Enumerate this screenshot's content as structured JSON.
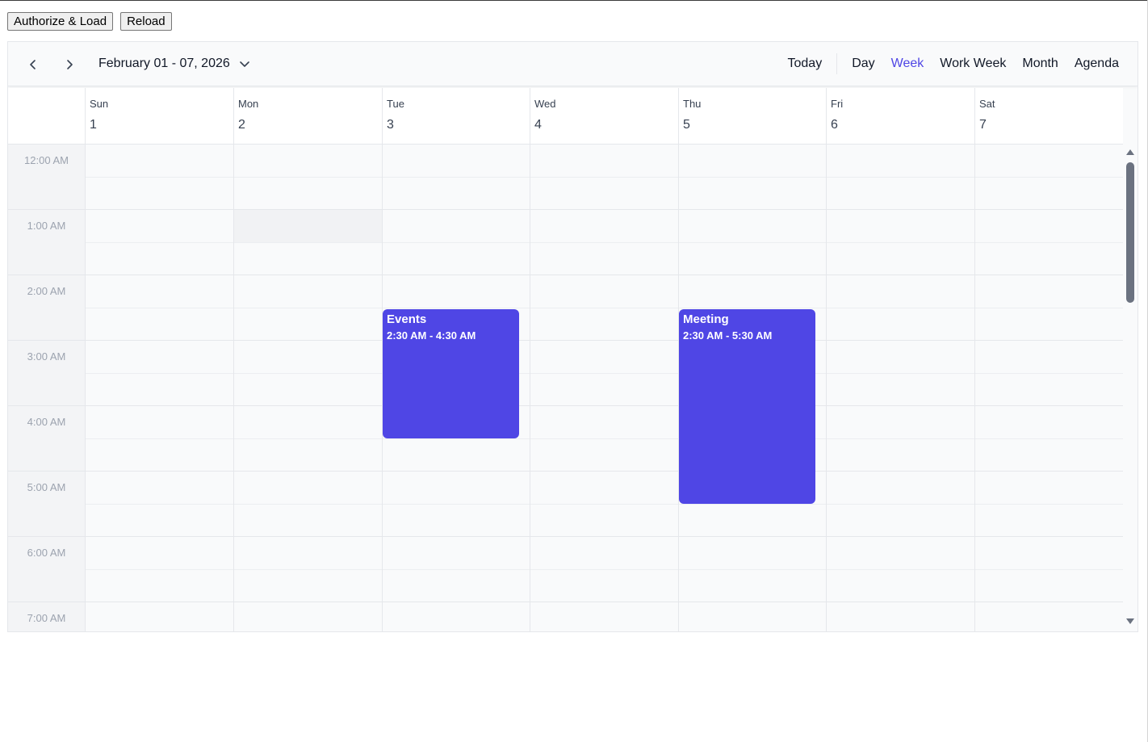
{
  "top_buttons": {
    "authorize_label": "Authorize & Load",
    "reload_label": "Reload"
  },
  "toolbar": {
    "date_range": "February 01 - 07, 2026",
    "today_label": "Today",
    "views": [
      "Day",
      "Week",
      "Work Week",
      "Month",
      "Agenda"
    ],
    "active_view": "Week"
  },
  "days": [
    {
      "name": "Sun",
      "num": "1"
    },
    {
      "name": "Mon",
      "num": "2"
    },
    {
      "name": "Tue",
      "num": "3"
    },
    {
      "name": "Wed",
      "num": "4"
    },
    {
      "name": "Thu",
      "num": "5"
    },
    {
      "name": "Fri",
      "num": "6"
    },
    {
      "name": "Sat",
      "num": "7"
    }
  ],
  "times": [
    "12:00 AM",
    "1:00 AM",
    "2:00 AM",
    "3:00 AM",
    "4:00 AM",
    "5:00 AM",
    "6:00 AM",
    "7:00 AM"
  ],
  "events": [
    {
      "title": "Events",
      "time": "2:30 AM - 4:30 AM",
      "day": "Tue"
    },
    {
      "title": "Meeting",
      "time": "2:30 AM - 5:30 AM",
      "day": "Thu"
    }
  ],
  "colors": {
    "accent": "#4f46e5",
    "event": "#4f46e5"
  }
}
